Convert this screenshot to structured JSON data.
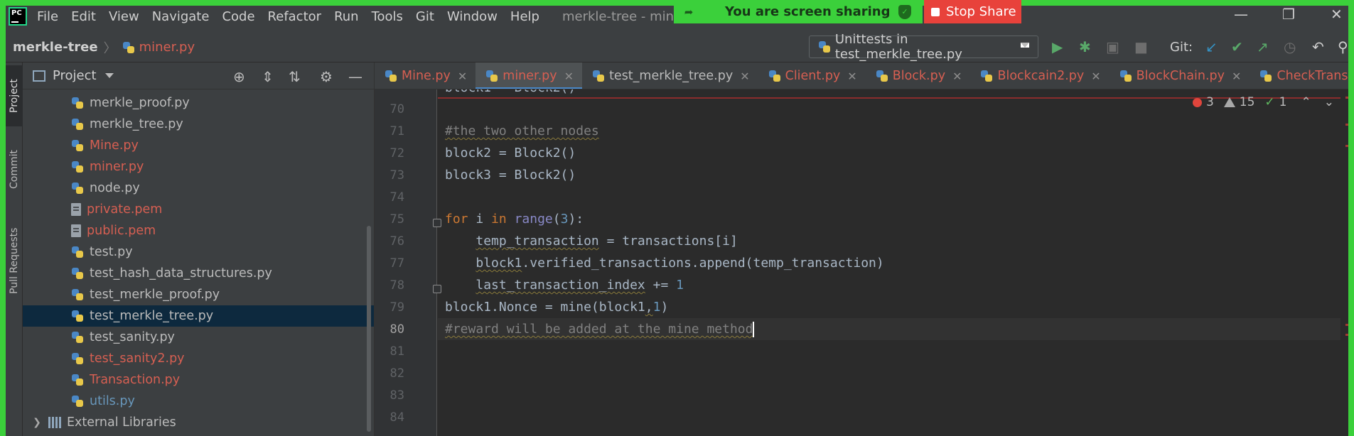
{
  "window": {
    "title": "merkle-tree - miner.py",
    "menu": [
      "File",
      "Edit",
      "View",
      "Navigate",
      "Code",
      "Refactor",
      "Run",
      "Tools",
      "Git",
      "Window",
      "Help"
    ],
    "logo_text": "PC"
  },
  "screen_share": {
    "banner_text": "You are screen sharing",
    "stop_label": "Stop Share",
    "border_color": "#3bd03b"
  },
  "navbar": {
    "project": "merkle-tree",
    "file": "miner.py",
    "run_config": "Unittests in test_merkle_tree.py",
    "git_label": "Git:"
  },
  "tool_stripe": {
    "tabs": [
      "Project",
      "Commit",
      "Pull Requests"
    ]
  },
  "project_panel": {
    "title": "Project",
    "files": [
      {
        "name": "merkle_proof.py",
        "icon": "python-file-icon",
        "status": "normal"
      },
      {
        "name": "merkle_tree.py",
        "icon": "python-file-icon",
        "status": "normal"
      },
      {
        "name": "Mine.py",
        "icon": "python-file-icon",
        "status": "modified"
      },
      {
        "name": "miner.py",
        "icon": "python-file-icon",
        "status": "modified"
      },
      {
        "name": "node.py",
        "icon": "python-file-icon",
        "status": "normal"
      },
      {
        "name": "private.pem",
        "icon": "text-file-icon",
        "status": "modified"
      },
      {
        "name": "public.pem",
        "icon": "text-file-icon",
        "status": "modified"
      },
      {
        "name": "test.py",
        "icon": "python-file-icon",
        "status": "normal"
      },
      {
        "name": "test_hash_data_structures.py",
        "icon": "python-file-icon",
        "status": "normal"
      },
      {
        "name": "test_merkle_proof.py",
        "icon": "python-file-icon",
        "status": "normal"
      },
      {
        "name": "test_merkle_tree.py",
        "icon": "python-file-icon",
        "status": "selected"
      },
      {
        "name": "test_sanity.py",
        "icon": "python-file-icon",
        "status": "normal"
      },
      {
        "name": "test_sanity2.py",
        "icon": "python-file-icon",
        "status": "modified"
      },
      {
        "name": "Transaction.py",
        "icon": "python-file-icon",
        "status": "modified"
      },
      {
        "name": "utils.py",
        "icon": "python-file-icon",
        "status": "changed"
      }
    ],
    "external_libraries": "External Libraries"
  },
  "editor": {
    "tabs": [
      {
        "label": "Mine.py",
        "status": "modified",
        "active": false
      },
      {
        "label": "miner.py",
        "status": "modified",
        "active": true
      },
      {
        "label": "test_merkle_tree.py",
        "status": "normal",
        "active": false
      },
      {
        "label": "Client.py",
        "status": "modified",
        "active": false
      },
      {
        "label": "Block.py",
        "status": "modified",
        "active": false
      },
      {
        "label": "Blockcain2.py",
        "status": "modified",
        "active": false
      },
      {
        "label": "BlockChain.py",
        "status": "modified",
        "active": false
      },
      {
        "label": "CheckTransaction.p",
        "status": "modified",
        "active": false
      }
    ],
    "inspections": {
      "errors": "3",
      "warnings": "15",
      "weak": "1"
    },
    "partial_top_line": "block1 = Block2()",
    "lines": [
      {
        "num": "70",
        "text": ""
      },
      {
        "num": "71",
        "text": "#the two other nodes"
      },
      {
        "num": "72",
        "text": "block2 = Block2()"
      },
      {
        "num": "73",
        "text": "block3 = Block2()"
      },
      {
        "num": "74",
        "text": ""
      },
      {
        "num": "75",
        "text": "for i in range(3):"
      },
      {
        "num": "76",
        "text": "    temp_transaction = transactions[i]"
      },
      {
        "num": "77",
        "text": "    block1.verified_transactions.append(temp_transaction)"
      },
      {
        "num": "78",
        "text": "    last_transaction_index += 1"
      },
      {
        "num": "79",
        "text": "block1.Nonce = mine(block1,1)"
      },
      {
        "num": "80",
        "text": "#reward will be added at the mine method"
      },
      {
        "num": "81",
        "text": ""
      },
      {
        "num": "82",
        "text": ""
      },
      {
        "num": "83",
        "text": ""
      },
      {
        "num": "84",
        "text": ""
      }
    ],
    "caret_line": "80"
  }
}
